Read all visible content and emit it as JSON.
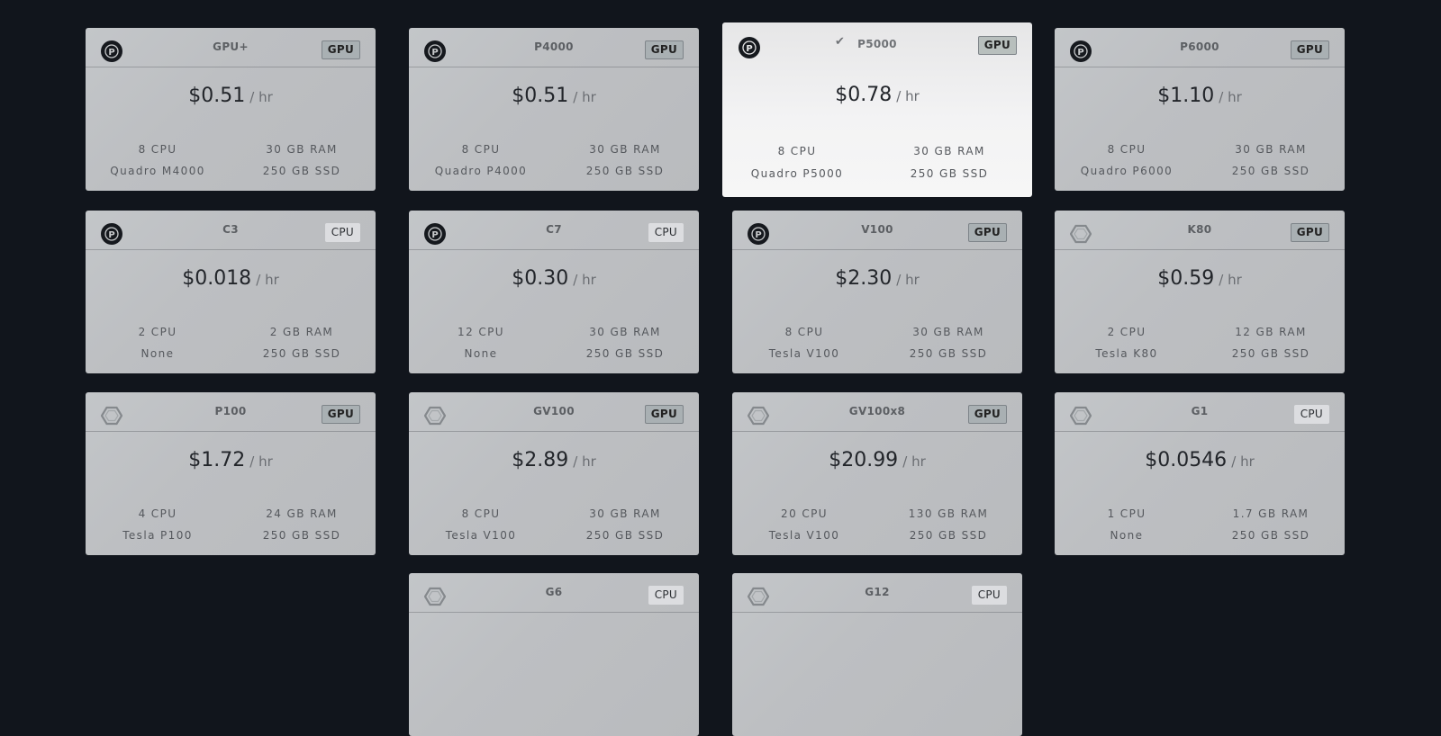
{
  "price_unit": "/ hr",
  "cards": [
    {
      "name": "GPU+",
      "type": "GPU",
      "price": "$0.51",
      "cpu": "8 CPU",
      "ram": "30 GB RAM",
      "gpu": "Quadro M4000",
      "ssd": "250 GB SSD",
      "logo": "paperspace-icon"
    },
    {
      "name": "P4000",
      "type": "GPU",
      "price": "$0.51",
      "cpu": "8 CPU",
      "ram": "30 GB RAM",
      "gpu": "Quadro P4000",
      "ssd": "250 GB SSD",
      "logo": "paperspace-icon"
    },
    {
      "name": "P5000",
      "type": "GPU",
      "price": "$0.78",
      "cpu": "8 CPU",
      "ram": "30 GB RAM",
      "gpu": "Quadro P5000",
      "ssd": "250 GB SSD",
      "logo": "paperspace-icon",
      "selected": true
    },
    {
      "name": "P6000",
      "type": "GPU",
      "price": "$1.10",
      "cpu": "8 CPU",
      "ram": "30 GB RAM",
      "gpu": "Quadro P6000",
      "ssd": "250 GB SSD",
      "logo": "paperspace-icon"
    },
    {
      "name": "C3",
      "type": "CPU",
      "price": "$0.018",
      "cpu": "2 CPU",
      "ram": "2 GB RAM",
      "gpu": "None",
      "ssd": "250 GB SSD",
      "logo": "paperspace-icon"
    },
    {
      "name": "C7",
      "type": "CPU",
      "price": "$0.30",
      "cpu": "12 CPU",
      "ram": "30 GB RAM",
      "gpu": "None",
      "ssd": "250 GB SSD",
      "logo": "paperspace-icon"
    },
    {
      "name": "V100",
      "type": "GPU",
      "price": "$2.30",
      "cpu": "8 CPU",
      "ram": "30 GB RAM",
      "gpu": "Tesla V100",
      "ssd": "250 GB SSD",
      "logo": "paperspace-icon"
    },
    {
      "name": "K80",
      "type": "GPU",
      "price": "$0.59",
      "cpu": "2 CPU",
      "ram": "12 GB RAM",
      "gpu": "Tesla K80",
      "ssd": "250 GB SSD",
      "logo": "hexagon-icon"
    },
    {
      "name": "P100",
      "type": "GPU",
      "price": "$1.72",
      "cpu": "4 CPU",
      "ram": "24 GB RAM",
      "gpu": "Tesla P100",
      "ssd": "250 GB SSD",
      "logo": "hexagon-icon"
    },
    {
      "name": "GV100",
      "type": "GPU",
      "price": "$2.89",
      "cpu": "8 CPU",
      "ram": "30 GB RAM",
      "gpu": "Tesla V100",
      "ssd": "250 GB SSD",
      "logo": "hexagon-icon"
    },
    {
      "name": "GV100x8",
      "type": "GPU",
      "price": "$20.99",
      "cpu": "20 CPU",
      "ram": "130 GB RAM",
      "gpu": "Tesla V100",
      "ssd": "250 GB SSD",
      "logo": "hexagon-icon"
    },
    {
      "name": "G1",
      "type": "CPU",
      "price": "$0.0546",
      "cpu": "1 CPU",
      "ram": "1.7 GB RAM",
      "gpu": "None",
      "ssd": "250 GB SSD",
      "logo": "hexagon-icon"
    },
    {
      "name": "G6",
      "type": "CPU",
      "logo": "hexagon-icon"
    },
    {
      "name": "G12",
      "type": "CPU",
      "logo": "hexagon-icon"
    }
  ]
}
